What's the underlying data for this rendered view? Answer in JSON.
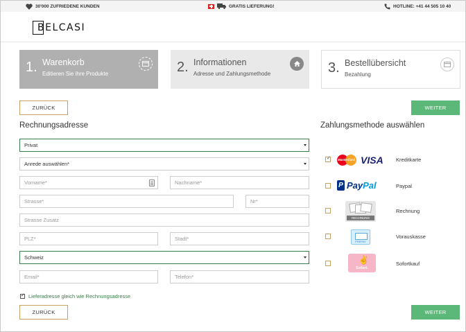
{
  "topbar": {
    "customers": "30'000 ZUFRIEDENE KUNDEN",
    "delivery": "GRATIS LIEFERUNG!",
    "hotline": "HOTLINE: +41 44 505 10 40"
  },
  "header": {
    "logo": "BELCASI"
  },
  "steps": [
    {
      "num": "1.",
      "title": "Warenkorb",
      "sub": "Editieren Sie ihre Produkte",
      "icon": "credit-card-icon"
    },
    {
      "num": "2.",
      "title": "Informationen",
      "sub": "Adresse und Zahlungsmethode",
      "icon": "home-icon"
    },
    {
      "num": "3.",
      "title": "Bestellübersicht",
      "sub": "Bezahlung",
      "icon": "credit-card-icon"
    }
  ],
  "buttons": {
    "back": "ZURÜCK",
    "next": "WEITER"
  },
  "billing": {
    "title": "Rechnungsadresse",
    "type_value": "Privat",
    "salutation_value": "Anrede auswählen*",
    "firstname_placeholder": "Vorname*",
    "lastname_placeholder": "Nachname*",
    "street_placeholder": "Strasse*",
    "number_placeholder": "Nr*",
    "street_extra_placeholder": "Strasse Zusatz",
    "zip_placeholder": "PLZ*",
    "city_placeholder": "Stadt*",
    "country_value": "Schweiz",
    "email_placeholder": "Email*",
    "phone_placeholder": "Telefon*",
    "same_address_label": "Lieferadresse gleich wie Rechnungsadresse"
  },
  "payment": {
    "title": "Zahlungsmethode auswählen",
    "methods": [
      {
        "label": "Kreditkarte",
        "checked": true
      },
      {
        "label": "Paypal",
        "checked": false
      },
      {
        "label": "Rechnung",
        "checked": false
      },
      {
        "label": "Vorauskasse",
        "checked": false
      },
      {
        "label": "Sofortkauf",
        "checked": false
      }
    ],
    "logos": {
      "mastercard": "MasterCard",
      "visa": "VISA",
      "paypal_a": "Pay",
      "paypal_b": "Pal",
      "paypal_icon": "P",
      "rechnung": "RECHNUNG",
      "vorkasse": "PREPAY",
      "sofort": "Sofort."
    }
  },
  "colors": {
    "accent_green": "#5cb878",
    "border_gold": "#c8a060",
    "active_step": "#b0b0b0"
  }
}
